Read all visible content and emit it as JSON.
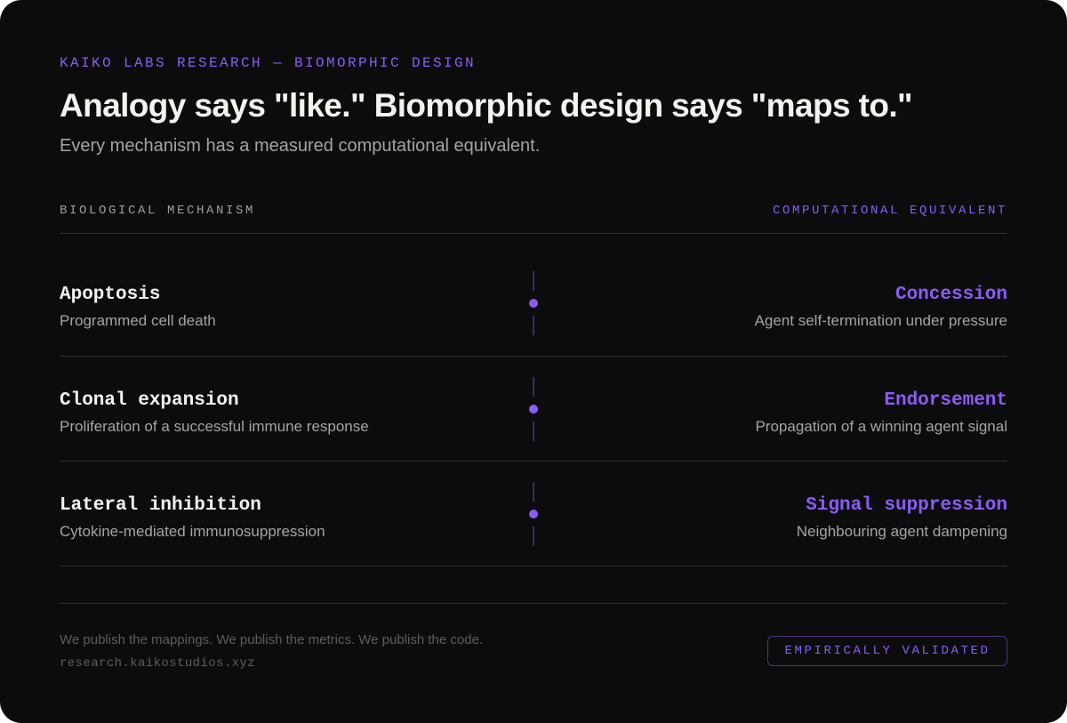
{
  "eyebrow": "KAIKO LABS RESEARCH — BIOMORPHIC DESIGN",
  "headline": "Analogy says \"like.\" Biomorphic design says \"maps to.\"",
  "subhead": "Every mechanism has a measured computational equivalent.",
  "columns": {
    "left": "BIOLOGICAL MECHANISM",
    "right": "COMPUTATIONAL EQUIVALENT"
  },
  "mappings": [
    {
      "bio_name": "Apoptosis",
      "bio_desc": "Programmed cell death",
      "comp_name": "Concession",
      "comp_desc": "Agent self-termination under pressure"
    },
    {
      "bio_name": "Clonal expansion",
      "bio_desc": "Proliferation of a successful immune response",
      "comp_name": "Endorsement",
      "comp_desc": "Propagation of a winning agent signal"
    },
    {
      "bio_name": "Lateral inhibition",
      "bio_desc": "Cytokine-mediated immunosuppression",
      "comp_name": "Signal suppression",
      "comp_desc": "Neighbouring agent dampening"
    }
  ],
  "footer": {
    "tagline": "We publish the mappings. We publish the metrics. We publish the code.",
    "url": "research.kaikostudios.xyz",
    "badge": "EMPIRICALLY VALIDATED"
  },
  "colors": {
    "background": "#0c0c0d",
    "accent": "#8b5cf6",
    "text_primary": "#f4f2ee",
    "text_secondary": "#a6a4a1",
    "text_muted": "#5f5d5b",
    "divider": "#2e2e31"
  },
  "icons": {
    "connector": "dot-connector-icon"
  }
}
